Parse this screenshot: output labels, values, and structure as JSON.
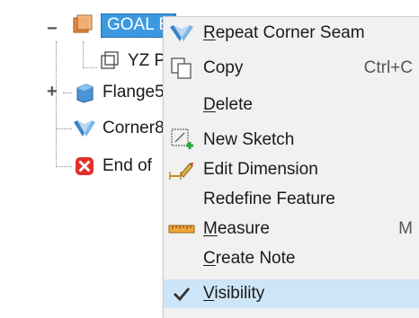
{
  "tree": {
    "items": [
      {
        "label": "GOAL E",
        "icon": "part-folder-icon",
        "expander": "−",
        "selected": true
      },
      {
        "label": "YZ P",
        "icon": "plane-icon"
      },
      {
        "label": "Flange5",
        "icon": "flange-icon",
        "expander": "+"
      },
      {
        "label": "Corner8",
        "icon": "corner-seam-icon"
      },
      {
        "label": "End of",
        "icon": "end-of-part-icon"
      }
    ]
  },
  "menu": {
    "items": [
      {
        "label": "Repeat Corner Seam",
        "mnemonic": "R",
        "icon": "corner-seam-icon"
      },
      {
        "label": "Copy",
        "shortcut": "Ctrl+C",
        "icon": "copy-icon"
      },
      {
        "label": "Delete",
        "mnemonic": "D"
      },
      {
        "label": "New Sketch",
        "icon": "new-sketch-icon"
      },
      {
        "label": "Edit Dimension",
        "icon": "edit-dimension-icon"
      },
      {
        "label": "Redefine Feature"
      },
      {
        "label": "Measure",
        "mnemonic": "M",
        "shortcut": "M",
        "icon": "ruler-icon"
      },
      {
        "label": "Create Note",
        "mnemonic": "C"
      },
      {
        "label": "Visibility",
        "mnemonic": "V",
        "checked": true,
        "icon": "checkmark-icon"
      }
    ]
  },
  "colors": {
    "selection": "#3b99e0",
    "checked_row": "#cde5f7",
    "error_red": "#e2312b",
    "corner_blue": "#3a84c9",
    "part_orange": "#e8893a"
  }
}
